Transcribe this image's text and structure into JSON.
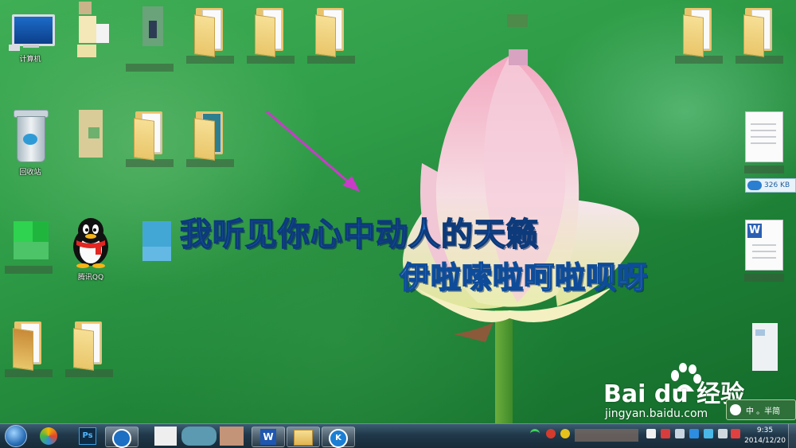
{
  "desktop": {
    "icons": {
      "computer": "计算机",
      "recycle_bin": "回收站",
      "qq": "腾讯QQ"
    },
    "file_size": "326 KB",
    "doc_icon_letter": "W"
  },
  "lyrics": {
    "line1": "我听见你心中动人的天籁",
    "line2": "伊啦嗦啦呵啦呗呀"
  },
  "watermark": {
    "brand": "Bai du 经验",
    "url": "jingyan.baidu.com"
  },
  "ime": {
    "label": "中 。半简"
  },
  "taskbar": {
    "apps": [
      "start-orb",
      "mail-app",
      "photoshop",
      "sogou-browser",
      "blank-window",
      "blurred-app-1",
      "blurred-app-2",
      "wps-writer",
      "file-explorer",
      "kugou"
    ],
    "ps_label": "Ps",
    "wps_label": "W",
    "kugou_label": "K",
    "clock": {
      "time": "9:35",
      "date": "2014/12/20"
    }
  },
  "colors": {
    "lyric_blue": "#1a6fd0",
    "taskbar": "#20384a",
    "accent_pink": "#c83cc8"
  }
}
